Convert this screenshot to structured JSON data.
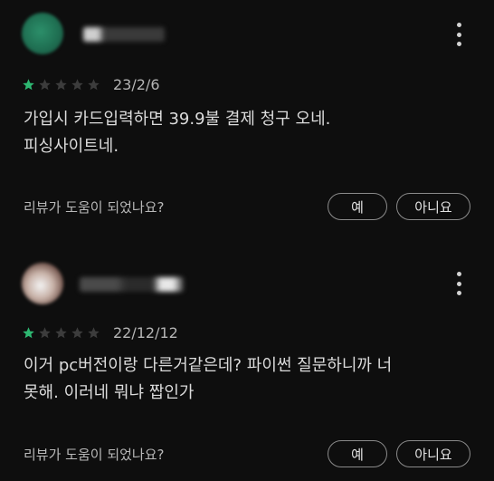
{
  "reviews": [
    {
      "rating": 1,
      "max_rating": 5,
      "date": "23/2/6",
      "text": "가입시 카드입력하면 39.9불 결제 청구 오네.\n피싱사이트네.",
      "helpful_question": "리뷰가 도움이 되었나요?",
      "yes_label": "예",
      "no_label": "아니요",
      "icons": [
        "avatar",
        "more-vert-icon",
        "star-icon"
      ]
    },
    {
      "rating": 1,
      "max_rating": 5,
      "date": "22/12/12",
      "text": "이거 pc버전이랑 다른거같은데? 파이썬 질문하니까 너\n못해. 이러네 뭐냐 짭인가",
      "helpful_question": "리뷰가 도움이 되었나요?",
      "yes_label": "예",
      "no_label": "아니요",
      "icons": [
        "avatar",
        "more-vert-icon",
        "star-icon"
      ]
    }
  ],
  "colors": {
    "background": "#0e0e0e",
    "star_filled": "#2eb872",
    "star_empty": "#3c3c3c",
    "text": "#dcdcdc"
  }
}
